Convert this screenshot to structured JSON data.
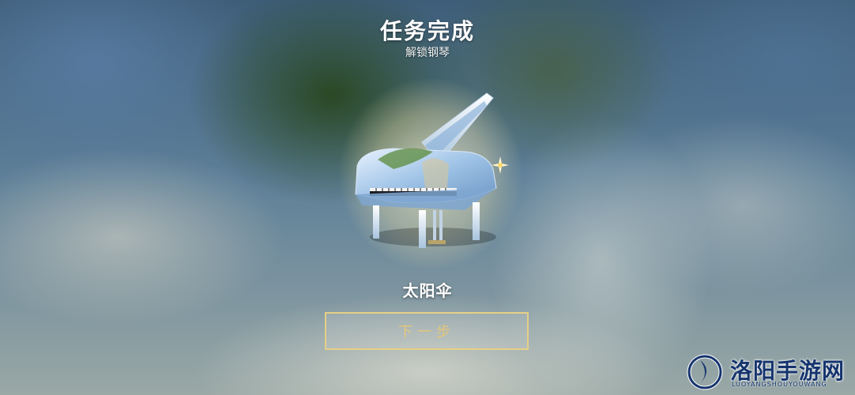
{
  "header": {
    "title": "任务完成",
    "subtitle": "解锁钢琴"
  },
  "reward": {
    "item_name": "太阳伞",
    "icon": "grand-piano-icon"
  },
  "actions": {
    "next_label": "下一步"
  },
  "watermark": {
    "brand": "洛阳手游网",
    "domain_text": "LUOYANGSHOUYOUWANG"
  },
  "colors": {
    "button_border": "#e6cf86",
    "button_text": "#e3c77a",
    "watermark": "#15346e"
  }
}
